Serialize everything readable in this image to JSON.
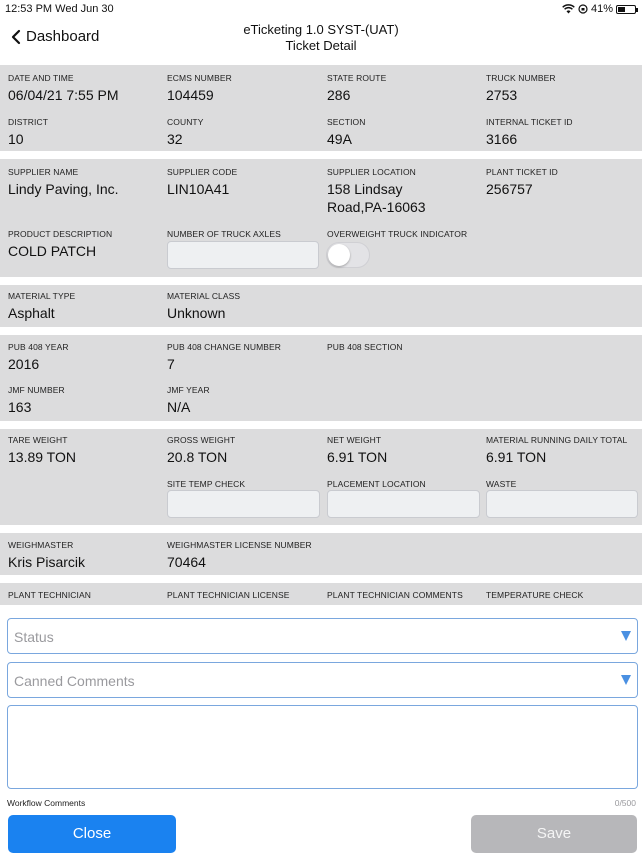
{
  "status": {
    "time": "12:53 PM  Wed Jun 30",
    "battery": "41%"
  },
  "nav": {
    "back_label": "Dashboard",
    "title_line1": "eTicketing 1.0 SYST-(UAT)",
    "title_line2": "Ticket Detail"
  },
  "s1": {
    "date_label": "DATE AND TIME",
    "date_value": "06/04/21 7:55 PM",
    "ecms_label": "ECMS NUMBER",
    "ecms_value": "104459",
    "route_label": "STATE ROUTE",
    "route_value": "286",
    "truck_label": "TRUCK NUMBER",
    "truck_value": "2753",
    "district_label": "DISTRICT",
    "district_value": "10",
    "county_label": "COUNTY",
    "county_value": "32",
    "section_label": "SECTION",
    "section_value": "49A",
    "internal_label": "INTERNAL TICKET ID",
    "internal_value": "3166"
  },
  "s2": {
    "supplier_name_label": "SUPPLIER NAME",
    "supplier_name_value": "Lindy Paving, Inc.",
    "supplier_code_label": "SUPPLIER CODE",
    "supplier_code_value": "LIN10A41",
    "supplier_loc_label": "SUPPLIER LOCATION",
    "supplier_loc_line1": "158 Lindsay",
    "supplier_loc_line2": "Road,PA-16063",
    "plant_ticket_label": "PLANT TICKET ID",
    "plant_ticket_value": "256757",
    "product_label": "PRODUCT DESCRIPTION",
    "product_value": "COLD PATCH",
    "axles_label": "NUMBER OF TRUCK AXLES",
    "overweight_label": "OVERWEIGHT TRUCK INDICATOR",
    "overweight_on": false
  },
  "s3": {
    "mtype_label": "MATERIAL TYPE",
    "mtype_value": "Asphalt",
    "mclass_label": "MATERIAL CLASS",
    "mclass_value": "Unknown"
  },
  "s4": {
    "pubyear_label": "PUB 408 YEAR",
    "pubyear_value": "2016",
    "pubchange_label": "PUB 408 CHANGE NUMBER",
    "pubchange_value": "7",
    "pubsection_label": "PUB 408 SECTION",
    "jmfnum_label": "JMF NUMBER",
    "jmfnum_value": "163",
    "jmfyear_label": "JMF YEAR",
    "jmfyear_value": "N/A"
  },
  "s5": {
    "tare_label": "TARE WEIGHT",
    "tare_value": "13.89 TON",
    "gross_label": "GROSS WEIGHT",
    "gross_value": "20.8 TON",
    "net_label": "NET WEIGHT",
    "net_value": "6.91 TON",
    "running_label": "MATERIAL RUNNING DAILY TOTAL",
    "running_value": "6.91 TON",
    "sitetemp_label": "SITE TEMP CHECK",
    "placement_label": "PLACEMENT LOCATION",
    "waste_label": "WASTE"
  },
  "s6": {
    "wm_label": "WEIGHMASTER",
    "wm_value": "Kris Pisarcik",
    "wmlic_label": "WEIGHMASTER LICENSE NUMBER",
    "wmlic_value": "70464"
  },
  "s7": {
    "tech_label": "PLANT TECHNICIAN",
    "techlic_label": "PLANT TECHNICIAN LICENSE",
    "techcomments_label": "PLANT TECHNICIAN COMMENTS",
    "tempcheck_label": "TEMPERATURE CHECK"
  },
  "form": {
    "status_placeholder": "Status",
    "canned_placeholder": "Canned Comments",
    "workflow_label": "Workflow Comments",
    "counter": "0/500",
    "close_label": "Close",
    "save_label": "Save"
  },
  "colors": {
    "accent": "#1a82f0",
    "section_bg": "#dcdcdd",
    "disabled_button": "#b7b7ba"
  }
}
